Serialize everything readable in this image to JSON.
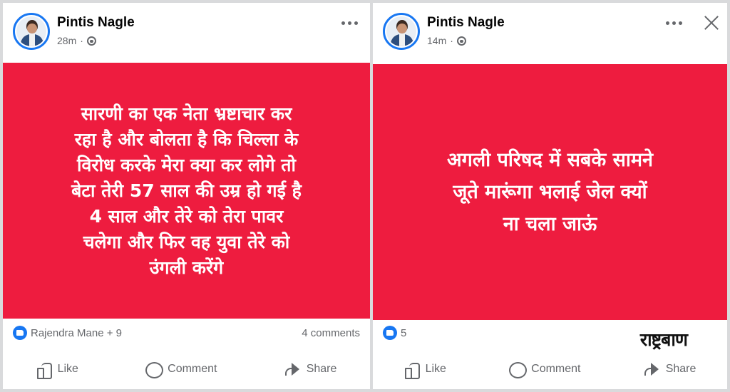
{
  "colors": {
    "card_red": "#ee1c3f",
    "brand_blue": "#1877f2",
    "muted": "#65676b"
  },
  "icons": [
    "more-icon",
    "close-icon",
    "globe-icon",
    "like-badge-icon",
    "thumb-icon",
    "comment-icon",
    "share-icon"
  ],
  "posts": [
    {
      "author": "Pintis Nagle",
      "time": "28m",
      "separator": "·",
      "card_lines": [
        "सारणी का एक नेता  भ्रष्टाचार कर",
        "रहा है और बोलता है कि चिल्ला के",
        "विरोध करके मेरा क्या कर लोगे तो",
        "बेटा तेरी 57 साल की उम्र हो गई है",
        "4 साल और तेरे को तेरा पावर",
        "चलेगा और फिर वह युवा तेरे को",
        "उंगली करेंगे"
      ],
      "reactions_text": "Rajendra Mane + 9",
      "comments_text": "4 comments",
      "actions": {
        "like": "Like",
        "comment": "Comment",
        "share": "Share"
      }
    },
    {
      "author": "Pintis Nagle",
      "time": "14m",
      "separator": "·",
      "card_lines": [
        "अगली परिषद में सबके सामने",
        "जूते मारूंगा भलाई जेल क्यों",
        "ना चला जाऊं"
      ],
      "reactions_text": "5",
      "watermark": "राष्ट्रबाण",
      "actions": {
        "like": "Like",
        "comment": "Comment",
        "share": "Share"
      }
    }
  ]
}
